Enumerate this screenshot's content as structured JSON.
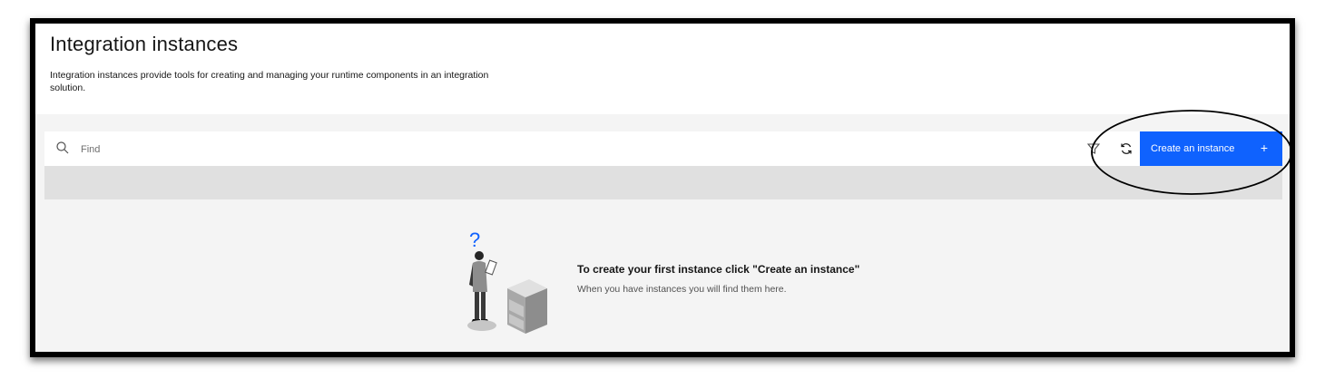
{
  "page": {
    "title": "Integration instances",
    "description": "Integration instances provide tools for creating and managing your runtime components in an integration solution."
  },
  "toolbar": {
    "search_placeholder": "Find",
    "create_button_label": "Create an instance",
    "create_button_icon": "+",
    "icons": [
      "search-icon",
      "filter-icon",
      "refresh-icon",
      "add-icon"
    ]
  },
  "empty_state": {
    "heading": "To create your first instance click \"Create an instance\"",
    "subtext": "When you have instances you will find them here.",
    "illustration": "person-with-question-and-filing-cabinet",
    "question_mark": "?"
  },
  "colors": {
    "primary": "#0f62fe",
    "background": "#f4f4f4",
    "band": "#e0e0e0",
    "text": "#161616"
  }
}
